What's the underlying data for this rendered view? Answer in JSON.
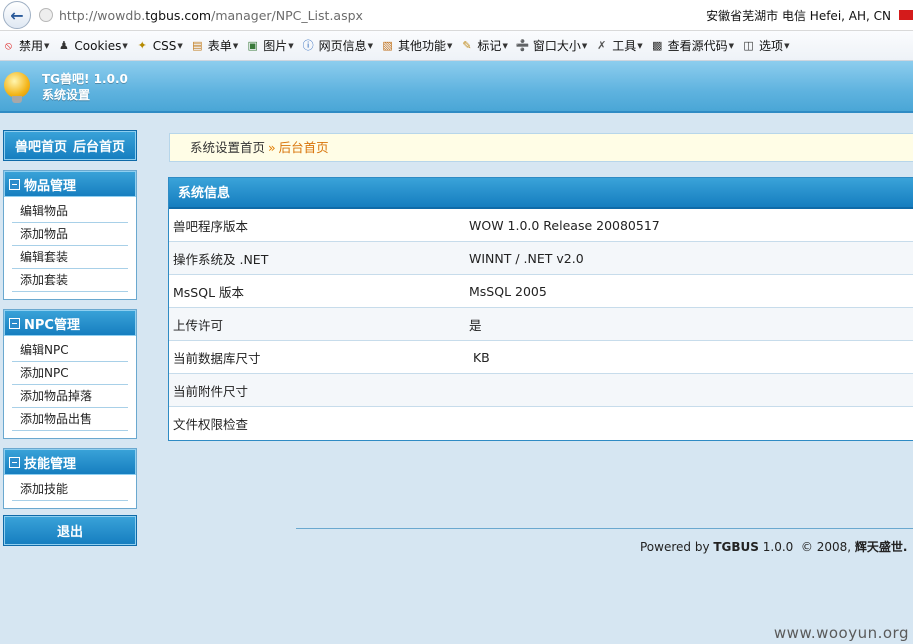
{
  "browser": {
    "url_prefix": "http://wowdb.",
    "url_domain": "tgbus.com",
    "url_path": "/manager/NPC_List.aspx",
    "geo": "安徽省芜湖市 电信   Hefei, AH, CN",
    "flag_color": "#d41b1b"
  },
  "toolbar": {
    "items": [
      {
        "label": "禁用",
        "icon": "no-entry-icon"
      },
      {
        "label": "Cookies",
        "icon": "person-icon"
      },
      {
        "label": "CSS",
        "icon": "wand-icon"
      },
      {
        "label": "表单",
        "icon": "clipboard-icon"
      },
      {
        "label": "图片",
        "icon": "image-icon"
      },
      {
        "label": "网页信息",
        "icon": "info-icon"
      },
      {
        "label": "其他功能",
        "icon": "book-icon"
      },
      {
        "label": "标记",
        "icon": "pencil-icon"
      },
      {
        "label": "窗口大小",
        "icon": "ruler-icon"
      },
      {
        "label": "工具",
        "icon": "tools-icon"
      },
      {
        "label": "查看源代码",
        "icon": "console-icon"
      },
      {
        "label": "选项",
        "icon": "options-icon"
      }
    ]
  },
  "app": {
    "title": "TG兽吧! 1.0.0",
    "subtitle": "系统设置"
  },
  "sidebar": {
    "top_left": "兽吧首页",
    "top_right": "后台首页",
    "panels": [
      {
        "title": "物品管理",
        "items": [
          "编辑物品",
          "添加物品",
          "编辑套装",
          "添加套装"
        ]
      },
      {
        "title": "NPC管理",
        "items": [
          "编辑NPC",
          "添加NPC",
          "添加物品掉落",
          "添加物品出售"
        ]
      },
      {
        "title": "技能管理",
        "items": [
          "添加技能"
        ]
      }
    ],
    "logout": "退出"
  },
  "breadcrumb": {
    "root": "系统设置首页",
    "separator": "»",
    "current": "后台首页"
  },
  "info": {
    "title": "系统信息",
    "rows": [
      {
        "key": "兽吧程序版本",
        "value": "WOW 1.0.0 Release 20080517"
      },
      {
        "key": "操作系统及 .NET",
        "value": "WINNT / .NET  v2.0"
      },
      {
        "key": "MsSQL 版本",
        "value": "MsSQL 2005"
      },
      {
        "key": "上传许可",
        "value": "是"
      },
      {
        "key": "当前数据库尺寸",
        "value": " KB"
      },
      {
        "key": "当前附件尺寸",
        "value": ""
      },
      {
        "key": "文件权限检查",
        "value": ""
      }
    ]
  },
  "footer": {
    "prefix": "Powered by ",
    "brand": "TGBUS",
    "version": " 1.0.0  © 2008, ",
    "owner": "辉天盛世."
  },
  "watermark": "www.wooyun.org"
}
